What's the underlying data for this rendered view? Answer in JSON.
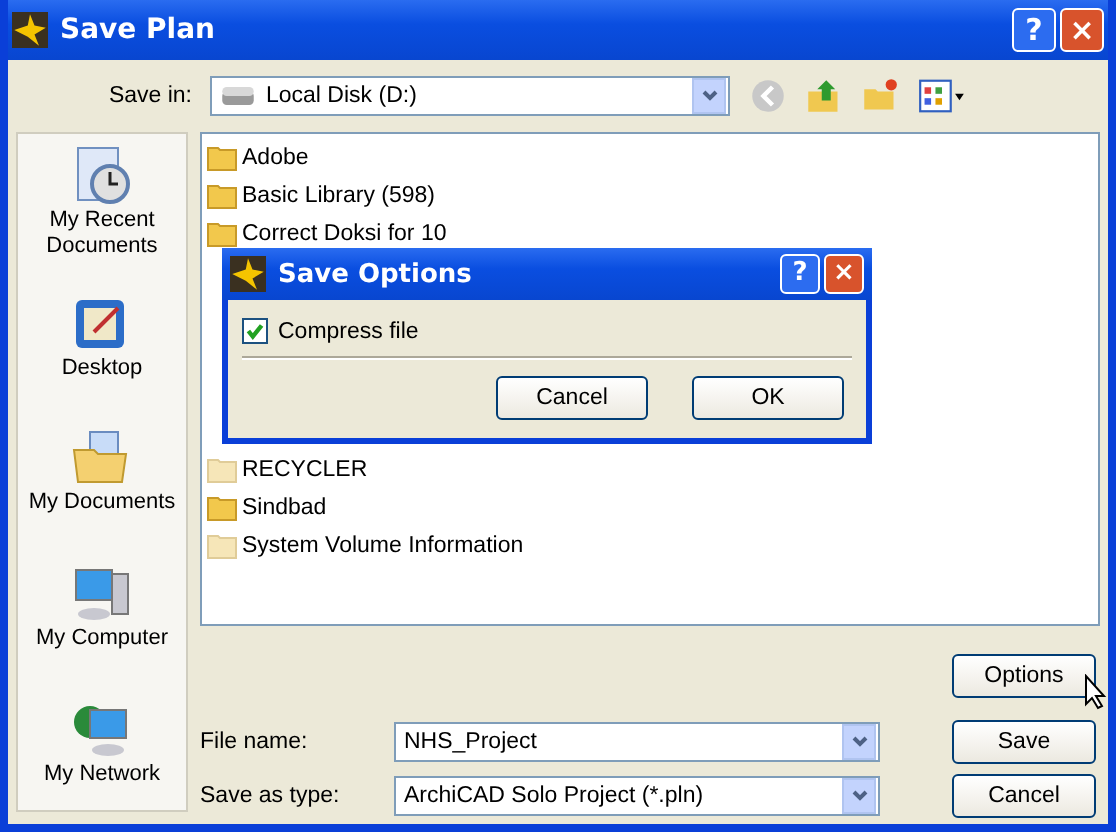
{
  "window": {
    "title": "Save Plan",
    "help": "?",
    "close": "×"
  },
  "save_in": {
    "label": "Save in:",
    "value": "Local Disk (D:)"
  },
  "places": [
    {
      "label": "My Recent Documents",
      "kind": "recent"
    },
    {
      "label": "Desktop",
      "kind": "desktop"
    },
    {
      "label": "My Documents",
      "kind": "documents"
    },
    {
      "label": "My Computer",
      "kind": "computer"
    },
    {
      "label": "My Network",
      "kind": "network"
    }
  ],
  "folders": [
    {
      "name": "Adobe",
      "hidden": false
    },
    {
      "name": "Basic Library (598)",
      "hidden": false
    },
    {
      "name": "Correct Doksi for 10",
      "hidden": false
    },
    {
      "name": "RECYCLER",
      "hidden": true
    },
    {
      "name": "Sindbad",
      "hidden": false
    },
    {
      "name": "System Volume Information",
      "hidden": true
    }
  ],
  "options_button": "Options",
  "file_name": {
    "label": "File name:",
    "value": "NHS_Project"
  },
  "save_as_type": {
    "label": "Save as type:",
    "value": "ArchiCAD Solo Project (*.pln)"
  },
  "buttons": [
    "Save",
    "Cancel"
  ],
  "modal": {
    "title": "Save Options",
    "help": "?",
    "close": "×",
    "checkbox": {
      "label": "Compress file",
      "checked": true
    },
    "buttons": [
      "Cancel",
      "OK"
    ]
  }
}
